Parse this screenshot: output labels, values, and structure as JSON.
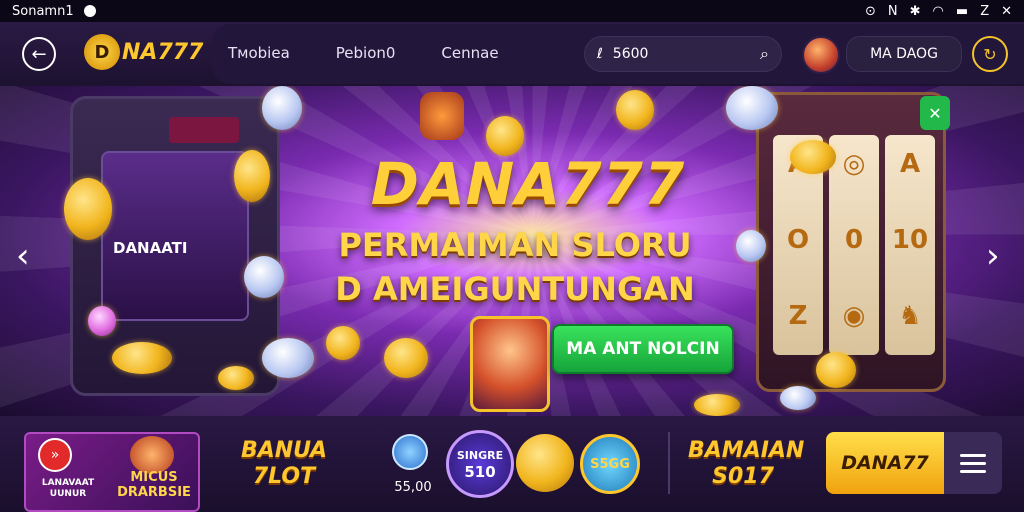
{
  "statusbar": {
    "left_text": "Sonamn1"
  },
  "topnav": {
    "brand": "NA777",
    "brand_badge": "D",
    "menu": [
      "Tмobiea",
      "Pebion0",
      "Cennae"
    ],
    "search_value": "5600",
    "username": "MA DAOG"
  },
  "hero": {
    "title": "DANA777",
    "subtitle_line1": "PERMAIMAN SLORU",
    "subtitle_line2": "D AMEIGUNTUNGAN",
    "cta_label": "MA ANT NOLCIN",
    "machine_left_text": "DANAATI"
  },
  "bottombar": {
    "promo_brand": "LANAVAAT UUNUR",
    "promo_title": "MICUS DRARBSIE",
    "label_left": "BANUA 7LOT",
    "chip_value": "55,00",
    "chip2_top": "SINGRE",
    "chip2_bottom": "510",
    "chip4_text": "S5GG",
    "label_right": "BAMAIAN S017",
    "dana_button": "DANA77"
  },
  "colors": {
    "accent_gold": "#ffc72e",
    "cta_green": "#22b84a",
    "background": "#1a0d2e"
  }
}
